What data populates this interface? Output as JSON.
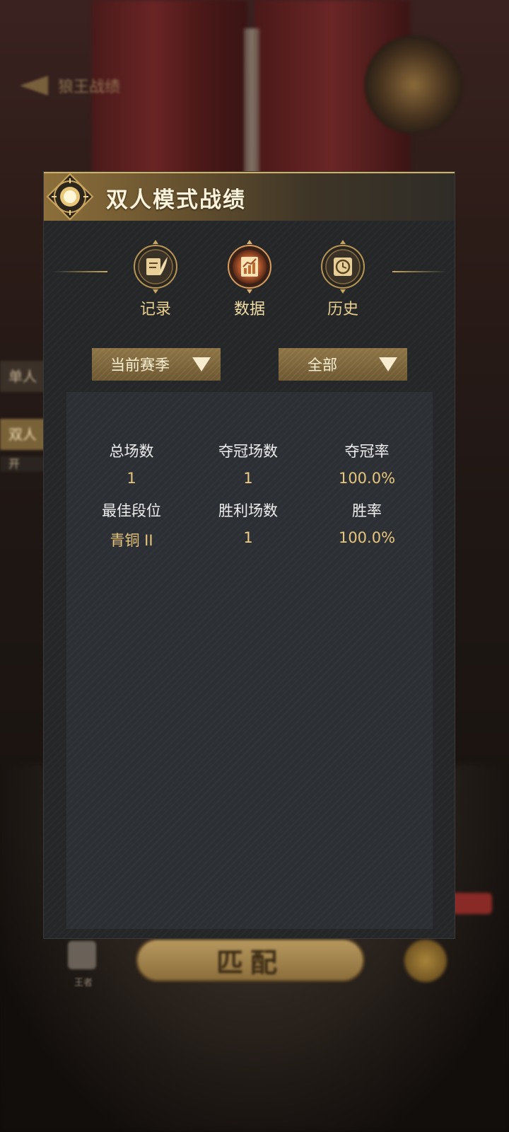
{
  "background": {
    "top_title": "狼王战绩",
    "side_tabs": [
      "单人",
      "双人",
      "开"
    ],
    "match_button": "匹配",
    "king_label": "王者"
  },
  "dialog": {
    "title": "双人模式战绩",
    "accent_color": "#d2b066",
    "tabs": [
      {
        "label": "记录",
        "icon": "quill-scroll-icon",
        "active": false
      },
      {
        "label": "数据",
        "icon": "chart-document-icon",
        "active": true
      },
      {
        "label": "历史",
        "icon": "clock-scroll-icon",
        "active": false
      }
    ],
    "season_filter": {
      "value": "当前赛季"
    },
    "mode_filter": {
      "value": "全部"
    },
    "stats": [
      [
        {
          "label": "总场数",
          "value": "1"
        },
        {
          "label": "夺冠场数",
          "value": "1"
        },
        {
          "label": "夺冠率",
          "value": "100.0%"
        }
      ],
      [
        {
          "label": "最佳段位",
          "value": "青铜 II"
        },
        {
          "label": "胜利场数",
          "value": "1"
        },
        {
          "label": "胜率",
          "value": "100.0%"
        }
      ]
    ]
  }
}
